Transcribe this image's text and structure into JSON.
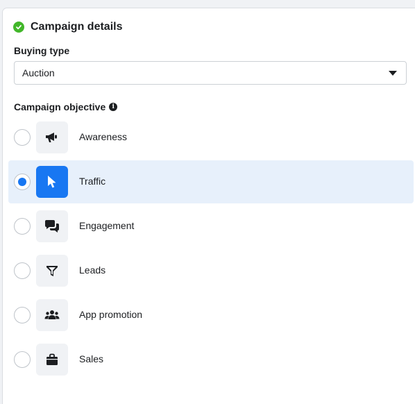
{
  "header": {
    "title": "Campaign details",
    "status_color": "#42b72a"
  },
  "buying_type": {
    "label": "Buying type",
    "value": "Auction"
  },
  "objective": {
    "label": "Campaign objective",
    "info_icon": "info-icon",
    "selected": "Traffic",
    "options": [
      {
        "label": "Awareness",
        "icon": "megaphone-icon",
        "selected": false
      },
      {
        "label": "Traffic",
        "icon": "cursor-icon",
        "selected": true
      },
      {
        "label": "Engagement",
        "icon": "chat-bubbles-icon",
        "selected": false
      },
      {
        "label": "Leads",
        "icon": "funnel-icon",
        "selected": false
      },
      {
        "label": "App promotion",
        "icon": "people-icon",
        "selected": false
      },
      {
        "label": "Sales",
        "icon": "shopping-bag-icon",
        "selected": false
      }
    ]
  },
  "colors": {
    "accent": "#1877f2",
    "selected_row": "#e7f0fb",
    "tile": "#f0f2f5"
  }
}
